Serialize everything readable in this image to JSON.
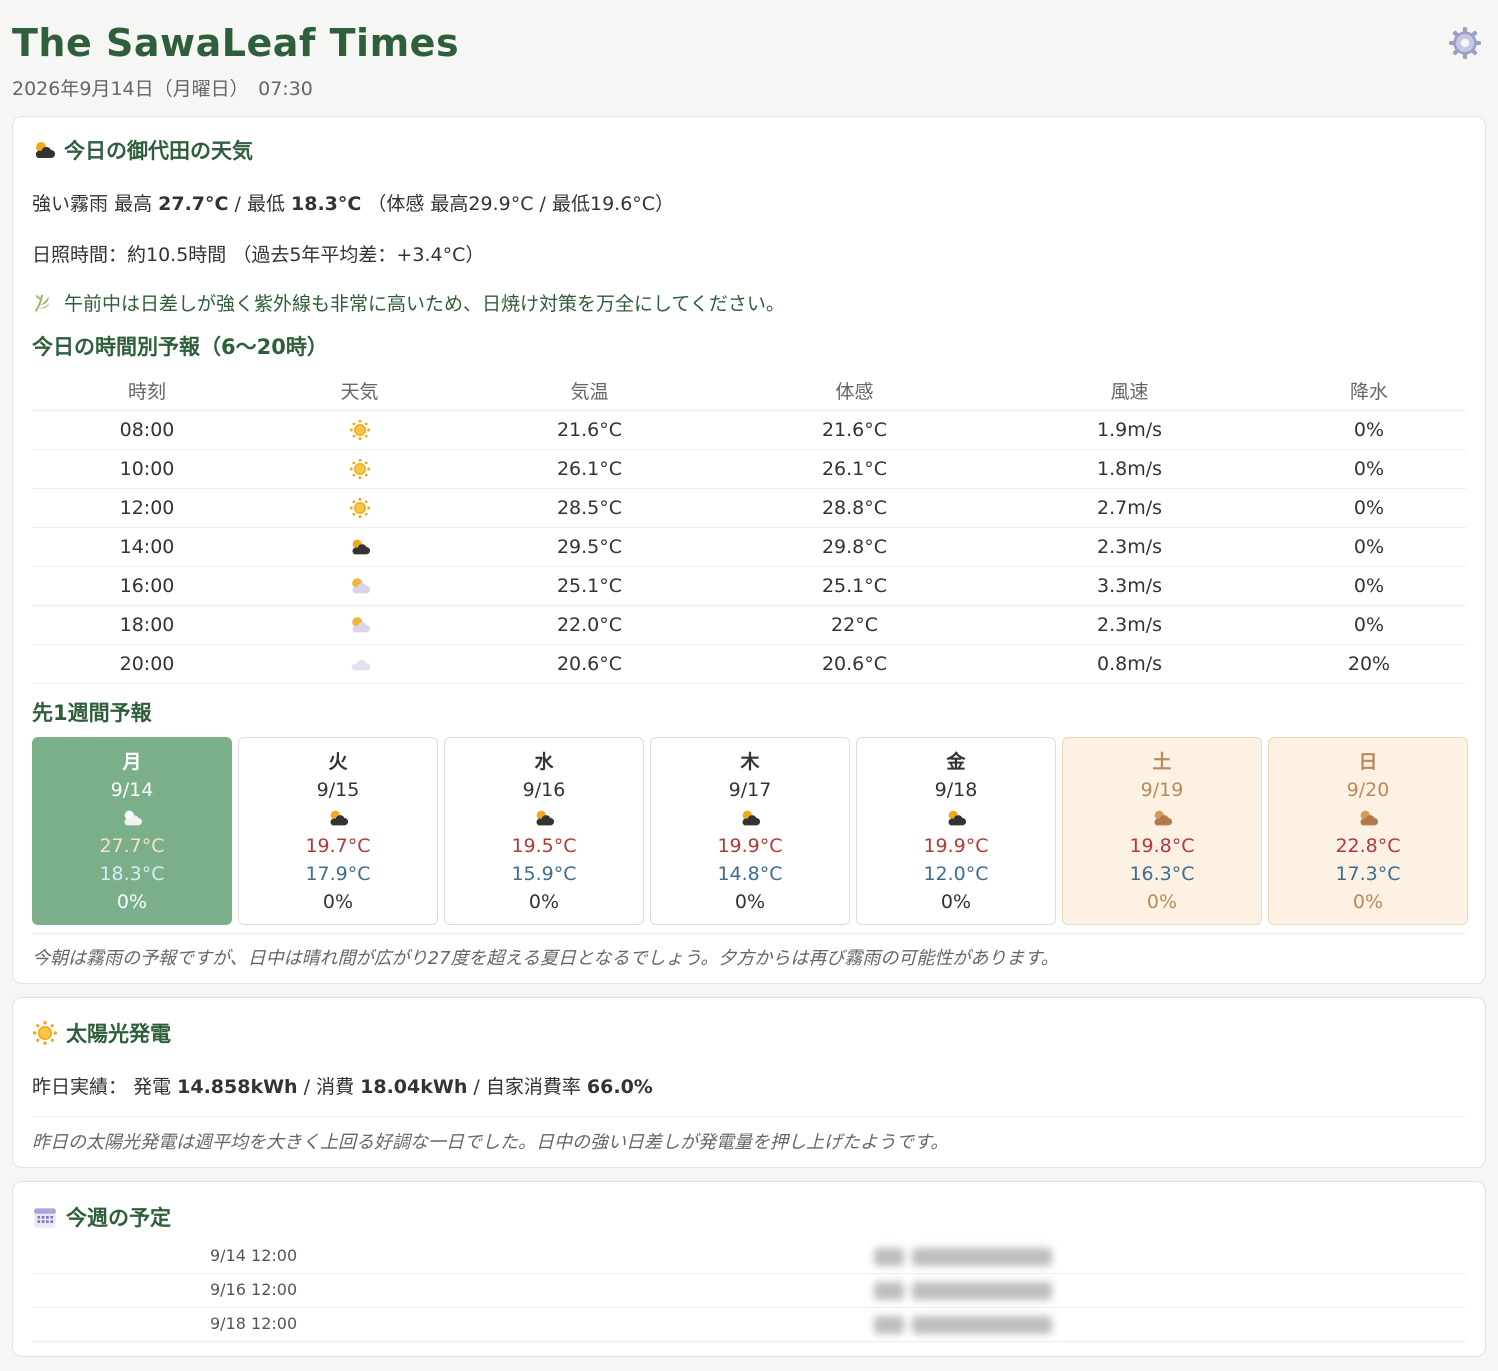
{
  "header": {
    "title": "The SawaLeaf Times",
    "date": "2026年9月14日（月曜日）　07:30",
    "settings_icon": "gear-icon"
  },
  "weather": {
    "title": "今日の御代田の天気",
    "title_icon": "sun-behind-cloud-icon",
    "summary": {
      "condition": "強い霧雨",
      "max_label": "最高",
      "max": "27.7°C",
      "sep": "/",
      "min_label": "最低",
      "min": "18.3°C",
      "feels": "（体感 最高29.9°C / 最低19.6°C）"
    },
    "sunshine": "日照時間：約10.5時間 （過去5年平均差：+3.4°C）",
    "tip": "午前中は日差しが強く紫外線も非常に高いため、日焼け対策を万全にしてください。",
    "tip_icon": "herb-icon",
    "hourly_title": "今日の時間別予報（6〜20時）",
    "hourly_headers": [
      "時刻",
      "天気",
      "気温",
      "体感",
      "風速",
      "降水"
    ],
    "hourly": [
      {
        "time": "08:00",
        "icon": "sun-icon",
        "temp": "21.6°C",
        "feels": "21.6°C",
        "wind": "1.9m/s",
        "rain": "0%"
      },
      {
        "time": "10:00",
        "icon": "sun-icon",
        "temp": "26.1°C",
        "feels": "26.1°C",
        "wind": "1.8m/s",
        "rain": "0%"
      },
      {
        "time": "12:00",
        "icon": "sun-icon",
        "temp": "28.5°C",
        "feels": "28.8°C",
        "wind": "2.7m/s",
        "rain": "0%"
      },
      {
        "time": "14:00",
        "icon": "sun-behind-cloud-icon",
        "temp": "29.5°C",
        "feels": "29.8°C",
        "wind": "2.3m/s",
        "rain": "0%"
      },
      {
        "time": "16:00",
        "icon": "sun-behind-cloud-icon",
        "temp": "25.1°C",
        "feels": "25.1°C",
        "wind": "3.3m/s",
        "rain": "0%"
      },
      {
        "time": "18:00",
        "icon": "sun-behind-cloud-icon",
        "temp": "22.0°C",
        "feels": "22°C",
        "wind": "2.3m/s",
        "rain": "0%"
      },
      {
        "time": "20:00",
        "icon": "cloud-icon",
        "temp": "20.6°C",
        "feels": "20.6°C",
        "wind": "0.8m/s",
        "rain": "20%"
      }
    ],
    "weekly_title": "先1週間予報",
    "weekly": [
      {
        "dow": "月",
        "date": "9/14",
        "icon": "sun-behind-cloud-icon",
        "hi": "27.7°C",
        "lo": "18.3°C",
        "rain": "0%"
      },
      {
        "dow": "火",
        "date": "9/15",
        "icon": "sun-behind-cloud-icon",
        "hi": "19.7°C",
        "lo": "17.9°C",
        "rain": "0%"
      },
      {
        "dow": "水",
        "date": "9/16",
        "icon": "sun-behind-cloud-icon",
        "hi": "19.5°C",
        "lo": "15.9°C",
        "rain": "0%"
      },
      {
        "dow": "木",
        "date": "9/17",
        "icon": "sun-behind-cloud-icon",
        "hi": "19.9°C",
        "lo": "14.8°C",
        "rain": "0%"
      },
      {
        "dow": "金",
        "date": "9/18",
        "icon": "sun-behind-cloud-icon",
        "hi": "19.9°C",
        "lo": "12.0°C",
        "rain": "0%"
      },
      {
        "dow": "土",
        "date": "9/19",
        "icon": "sun-behind-cloud-icon",
        "hi": "19.8°C",
        "lo": "16.3°C",
        "rain": "0%"
      },
      {
        "dow": "日",
        "date": "9/20",
        "icon": "sun-behind-cloud-icon",
        "hi": "22.8°C",
        "lo": "17.3°C",
        "rain": "0%"
      }
    ],
    "comment": "今朝は霧雨の予報ですが、日中は晴れ間が広がり27度を超える夏日となるでしょう。夕方からは再び霧雨の可能性があります。"
  },
  "solar": {
    "title": "太陽光発電",
    "title_icon": "sun-icon",
    "label": "昨日実績：",
    "gen_label": "発電",
    "gen": "14.858kWh",
    "sep": "/",
    "use_label": "消費",
    "use": "18.04kWh",
    "rate_label": "自家消費率",
    "rate": "66.0%",
    "comment": "昨日の太陽光発電は週平均を大きく上回る好調な一日でした。日中の強い日差しが発電量を押し上げたようです。"
  },
  "schedule": {
    "title": "今週の予定",
    "title_icon": "calendar-icon",
    "items": [
      {
        "time": "9/14 12:00"
      },
      {
        "time": "9/16 12:00"
      },
      {
        "time": "9/18 12:00"
      }
    ]
  },
  "colors": {
    "brand_green": "#2e5e3a",
    "today_bg": "#7aaf8a",
    "weekend_bg": "#fcf1e2",
    "hi_temp": "#b03a3a",
    "lo_temp": "#3e6e8e"
  }
}
